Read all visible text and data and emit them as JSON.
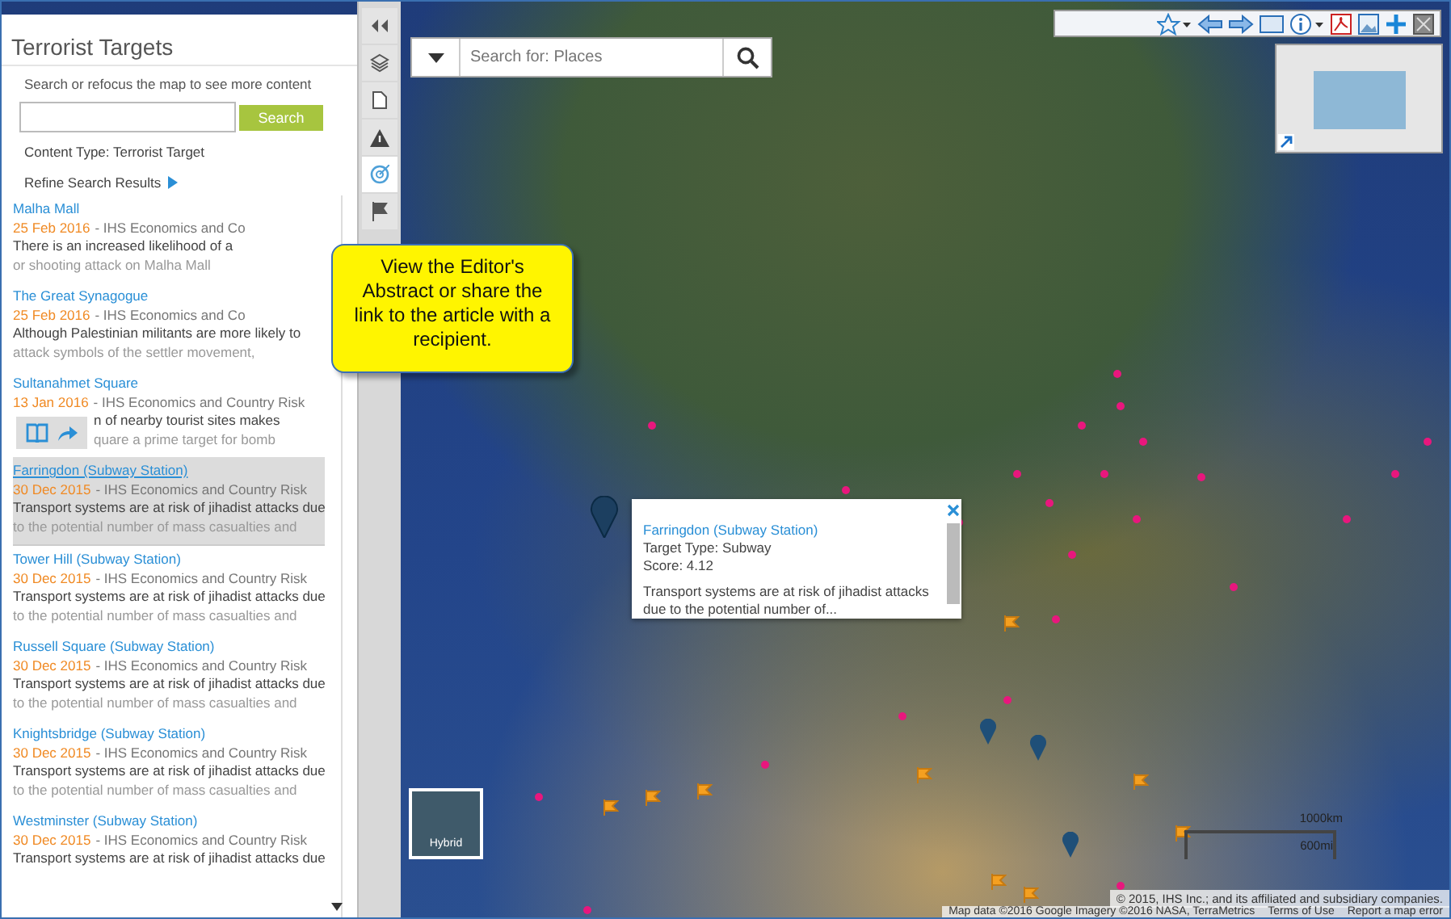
{
  "panel": {
    "title": "Terrorist Targets",
    "hint": "Search or refocus the map to see more content",
    "search": {
      "button": "Search"
    },
    "content_type": "Content Type: Terrorist Target",
    "refine": "Refine Search Results",
    "items": [
      {
        "title": "Malha Mall",
        "date": "25 Feb 2016",
        "source": "- IHS Economics and Co",
        "lines": [
          "There is an increased likelihood of a",
          "or shooting attack on Malha Mall"
        ],
        "selected": false,
        "indent": false
      },
      {
        "title": "The Great Synagogue",
        "date": "25 Feb 2016",
        "source": "- IHS Economics and Co",
        "lines": [
          "Although Palestinian militants are more likely to",
          "attack symbols of the settler movement,"
        ],
        "selected": false,
        "indent": false
      },
      {
        "title": "Sultanahmet Square",
        "date": "13 Jan 2016",
        "source": "- IHS Economics and Country Risk",
        "lines": [
          "n of nearby tourist sites makes",
          "quare a prime target for bomb"
        ],
        "selected": false,
        "indent": true
      },
      {
        "title": "Farringdon (Subway Station)",
        "date": "30 Dec 2015",
        "source": "- IHS Economics and Country Risk",
        "lines": [
          "Transport systems are at risk of jihadist attacks due",
          "to the potential number of mass casualties and"
        ],
        "selected": true,
        "indent": false
      },
      {
        "title": "Tower Hill (Subway Station)",
        "date": "30 Dec 2015",
        "source": "- IHS Economics and Country Risk",
        "lines": [
          "Transport systems are at risk of jihadist attacks due",
          "to the potential number of mass casualties and"
        ],
        "selected": false,
        "indent": false
      },
      {
        "title": "Russell Square (Subway Station)",
        "date": "30 Dec 2015",
        "source": "- IHS Economics and Country Risk",
        "lines": [
          "Transport systems are at risk of jihadist attacks due",
          "to the potential number of mass casualties and"
        ],
        "selected": false,
        "indent": false
      },
      {
        "title": "Knightsbridge (Subway Station)",
        "date": "30 Dec 2015",
        "source": "- IHS Economics and Country Risk",
        "lines": [
          "Transport systems are at risk of jihadist attacks due",
          "to the potential number of mass casualties and"
        ],
        "selected": false,
        "indent": false
      },
      {
        "title": "Westminster (Subway Station)",
        "date": "30 Dec 2015",
        "source": "- IHS Economics and Country Risk",
        "lines": [
          "Transport systems are at risk of jihadist attacks due"
        ],
        "selected": false,
        "indent": false
      }
    ]
  },
  "rail": [
    {
      "kind": "collapse",
      "selected": false
    },
    {
      "kind": "layers",
      "selected": false
    },
    {
      "kind": "page",
      "selected": false
    },
    {
      "kind": "warning",
      "selected": false
    },
    {
      "kind": "target",
      "selected": true
    },
    {
      "kind": "flag",
      "selected": false
    }
  ],
  "callout": "View the Editor's Abstract or share the link to the article with a recipient.",
  "map": {
    "search_placeholder": "Search for: Places",
    "basemap": "Hybrid",
    "popup": {
      "title": "Farringdon (Subway Station)",
      "type": "Target Type: Subway",
      "score": "Score: 4.12",
      "text": "Transport systems are at risk of jihadist attacks due to the potential number of..."
    },
    "scale": [
      "1000km",
      "600mi"
    ],
    "copyright": "© 2015, IHS Inc.; and its affiliated and subsidiary companies.",
    "footer": [
      "Map data ©2016 Google Imagery ©2016 NASA, TerraMetrics",
      "Terms of Use",
      "Report a map error"
    ]
  }
}
